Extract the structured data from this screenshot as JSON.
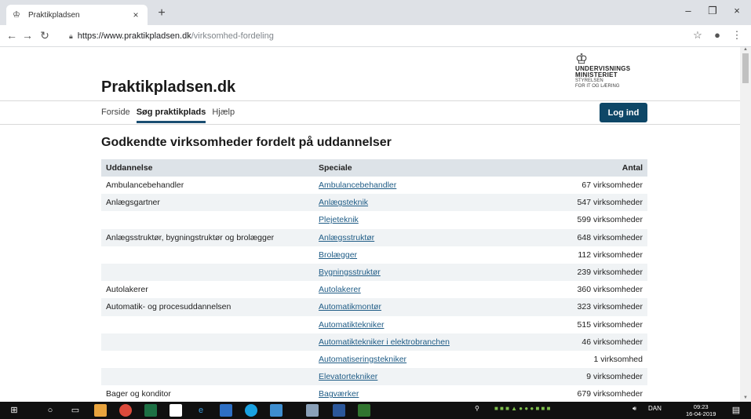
{
  "browser": {
    "tab_title": "Praktikpladsen",
    "tab_close": "×",
    "new_tab": "+",
    "url_host": "https://www.praktikpladsen.dk",
    "url_path": "/virksomhed-fordeling",
    "minimize": "–",
    "maximize": "❐",
    "close": "×"
  },
  "site": {
    "title": "Praktikpladsen.dk",
    "ministry_line1": "UNDERVISNINGS",
    "ministry_line2": "MINISTERIET",
    "ministry_line3": "STYRELSEN",
    "ministry_line4": "FOR IT OG LÆRING"
  },
  "nav": {
    "items": [
      "Forside",
      "Søg praktikplads",
      "Hjælp"
    ],
    "login": "Log ind"
  },
  "heading": "Godkendte virksomheder fordelt på uddannelser",
  "table": {
    "headers": [
      "Uddannelse",
      "Speciale",
      "Antal"
    ],
    "rows": [
      [
        "Ambulancebehandler",
        "Ambulancebehandler",
        "67 virksomheder"
      ],
      [
        "Anlægsgartner",
        "Anlægsteknik",
        "547 virksomheder"
      ],
      [
        "",
        "Plejeteknik",
        "599 virksomheder"
      ],
      [
        "Anlægsstruktør, bygningstruktør og brolægger",
        "Anlægsstruktør",
        "648 virksomheder"
      ],
      [
        "",
        "Brolægger",
        "112 virksomheder"
      ],
      [
        "",
        "Bygningsstruktør",
        "239 virksomheder"
      ],
      [
        "Autolakerer",
        "Autolakerer",
        "360 virksomheder"
      ],
      [
        "Automatik- og procesuddannelsen",
        "Automatikmontør",
        "323 virksomheder"
      ],
      [
        "",
        "Automatiktekniker",
        "515 virksomheder"
      ],
      [
        "",
        "Automatiktekniker i elektrobranchen",
        "46 virksomheder"
      ],
      [
        "",
        "Automatiseringstekniker",
        "1 virksomhed"
      ],
      [
        "",
        "Elevatortekniker",
        "9 virksomheder"
      ],
      [
        "Bager og konditor",
        "Bagværker",
        "679 virksomheder"
      ]
    ]
  },
  "taskbar": {
    "lang": "DAN",
    "time": "09:23",
    "date": "16-04-2019"
  }
}
